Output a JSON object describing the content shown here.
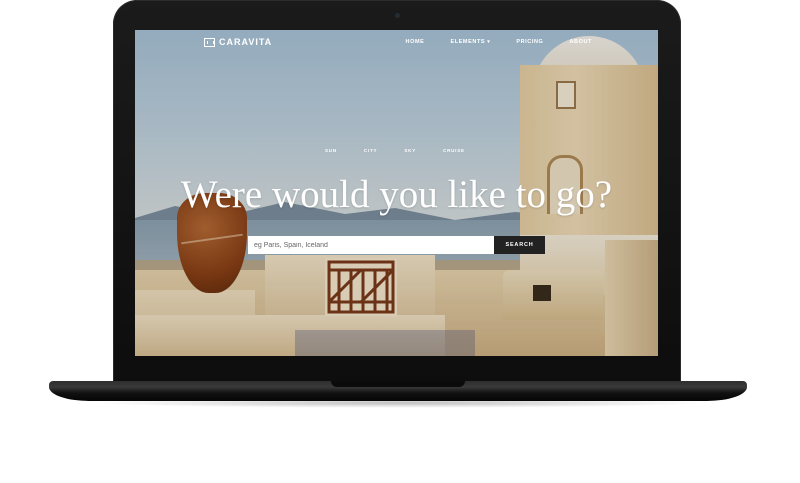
{
  "brand": {
    "name": "CARAVITA",
    "logo_icon": "grid-frame-icon"
  },
  "nav": {
    "items": [
      {
        "label": "HOME"
      },
      {
        "label": "ELEMENTS",
        "has_dropdown": true
      },
      {
        "label": "PRICING"
      },
      {
        "label": "ABOUT"
      }
    ]
  },
  "hero": {
    "categories": [
      "SUN",
      "CITY",
      "SKY",
      "CRUISE"
    ],
    "headline": "Were would you like to go?"
  },
  "search": {
    "placeholder": "eg Paris, Spain, Iceland",
    "value": "",
    "button_label": "SEARCH"
  },
  "colors": {
    "search_button_bg": "#222222",
    "nav_text": "#ffffff",
    "device_frame": "#111111"
  }
}
